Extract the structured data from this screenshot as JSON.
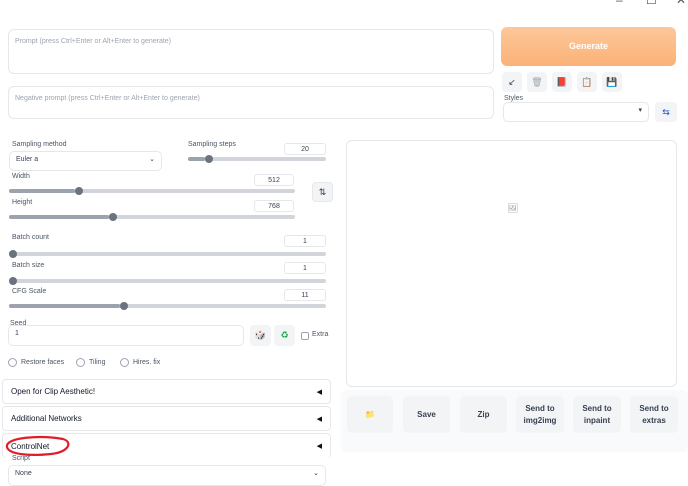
{
  "window": {
    "min": "–",
    "max": "☐",
    "close": "✕"
  },
  "prompt": {
    "placeholder": "Prompt (press Ctrl+Enter or Alt+Enter to generate)"
  },
  "negative_prompt": {
    "placeholder": "Negative prompt (press Ctrl+Enter or Alt+Enter to generate)"
  },
  "generate": {
    "label": "Generate"
  },
  "tools": {
    "arrow": "↙",
    "trash": "🗑",
    "book": "📕",
    "clipboard": "📋",
    "save": "💾"
  },
  "styles": {
    "label": "Styles",
    "value": "",
    "swap_icon": "⇆"
  },
  "sampling": {
    "method_label": "Sampling method",
    "method_value": "Euler a",
    "steps_label": "Sampling steps",
    "steps_value": "20"
  },
  "width": {
    "label": "Width",
    "value": "512",
    "fraction": 0.23
  },
  "height": {
    "label": "Height",
    "value": "768",
    "fraction": 0.35
  },
  "swap_dims_icon": "⇅",
  "batch_count": {
    "label": "Batch count",
    "value": "1",
    "fraction": 0
  },
  "batch_size": {
    "label": "Batch size",
    "value": "1",
    "fraction": 0
  },
  "cfg": {
    "label": "CFG Scale",
    "value": "11",
    "fraction": 0.35
  },
  "seed": {
    "label": "Seed",
    "value": "1",
    "dice": "🎲",
    "recycle": "♻",
    "extra_label": "Extra"
  },
  "options": {
    "restore_faces": "Restore faces",
    "tiling": "Tiling",
    "hires_fix": "Hires. fix"
  },
  "accordions": {
    "clip": "Open for Clip Aesthetic!",
    "networks": "Additional Networks",
    "controlnet": "ControlNet",
    "arrow": "◀"
  },
  "script": {
    "label": "Script",
    "value": "None"
  },
  "output": {
    "image_icon": "🖼"
  },
  "actions": {
    "folder": "📁",
    "save": "Save",
    "zip": "Zip",
    "send_img2img_1": "Send to",
    "send_img2img_2": "img2img",
    "send_inpaint_1": "Send to",
    "send_inpaint_2": "inpaint",
    "send_extras_1": "Send to",
    "send_extras_2": "extras"
  },
  "colors": {
    "generate": "#fbb277",
    "annotation": "#e11d2a"
  }
}
